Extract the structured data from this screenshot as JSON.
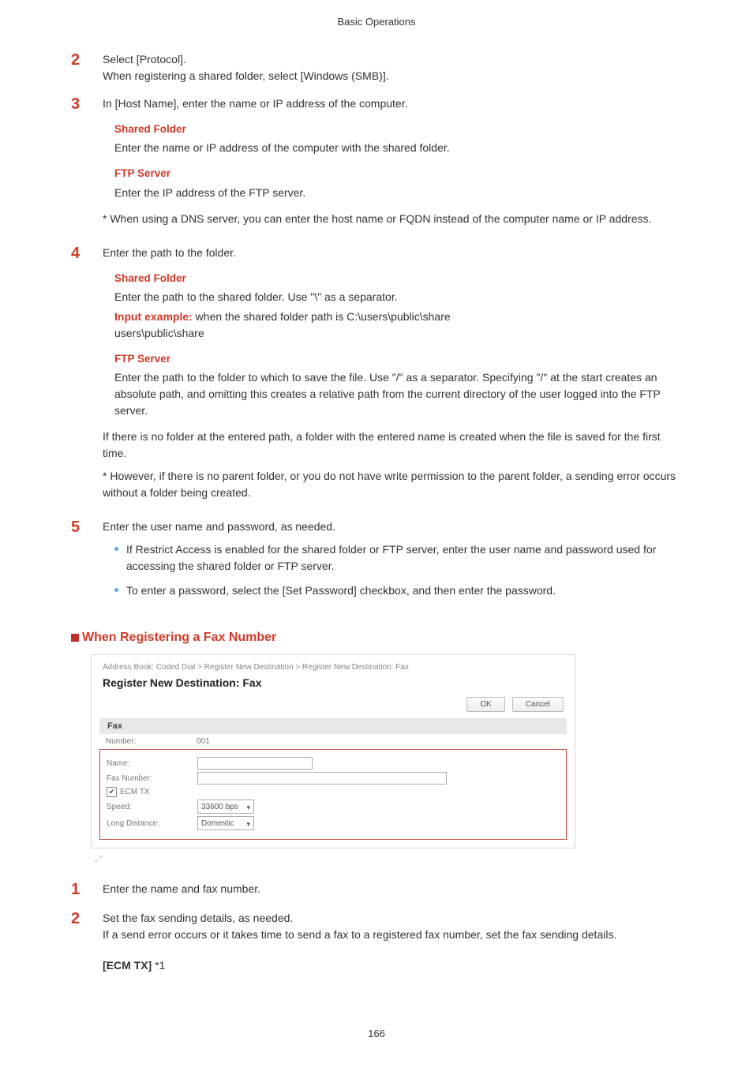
{
  "header": {
    "title": "Basic Operations"
  },
  "steps_a": [
    {
      "num": "2",
      "lines": [
        "Select [Protocol].",
        "When registering a shared folder, select [Windows (SMB)]."
      ]
    },
    {
      "num": "3",
      "lines": [
        "In [Host Name], enter the name or IP address of the computer."
      ],
      "subs": [
        {
          "heading": "Shared Folder",
          "body": "Enter the name or IP address of the computer with the shared folder."
        },
        {
          "heading": "FTP Server",
          "body": "Enter the IP address of the FTP server."
        }
      ],
      "note": "* When using a DNS server, you can enter the host name or FQDN instead of the computer name or IP address."
    },
    {
      "num": "4",
      "lines": [
        "Enter the path to the folder."
      ],
      "subs4": {
        "sf_heading": "Shared Folder",
        "sf_body": "Enter the path to the shared folder. Use \"\\\" as a separator.",
        "input_ex_label": "Input example:",
        "input_ex_text": " when the shared folder path is C:\\users\\public\\share",
        "input_ex_line2": "users\\public\\share",
        "ftp_heading": "FTP Server",
        "ftp_body": "Enter the path to the folder to which to save the file. Use \"/\" as a separator. Specifying \"/\" at the start creates an absolute path, and omitting this creates a relative path from the current directory of the user logged into the FTP server."
      },
      "extra": [
        "If there is no folder at the entered path, a folder with the entered name is created when the file is saved for the first time.",
        "* However, if there is no parent folder, or you do not have write permission to the parent folder, a sending error occurs without a folder being created."
      ]
    },
    {
      "num": "5",
      "lines": [
        "Enter the user name and password, as needed."
      ],
      "bullets": [
        "If Restrict Access is enabled for the shared folder or FTP server, enter the user name and password used for accessing the shared folder or FTP server.",
        "To enter a password, select the [Set Password] checkbox, and then enter the password."
      ]
    }
  ],
  "section": {
    "title": "When Registering a Fax Number"
  },
  "ui": {
    "breadcrumb": "Address Book: Coded Dial > Register New Destination > Register New Destination: Fax",
    "title": "Register New Destination: Fax",
    "ok": "OK",
    "cancel": "Cancel",
    "tab": "Fax",
    "rows": {
      "number_label": "Number:",
      "number_value": "001",
      "name_label": "Name:",
      "fax_label": "Fax Number:",
      "ecm_label": "ECM TX",
      "speed_label": "Speed:",
      "speed_value": "33600 bps",
      "long_label": "Long Distance:",
      "long_value": "Domestic"
    }
  },
  "steps_b": [
    {
      "num": "1",
      "lines": [
        "Enter the name and fax number."
      ]
    },
    {
      "num": "2",
      "lines": [
        "Set the fax sending details, as needed.",
        "If a send error occurs or it takes time to send a fax to a registered fax number, set the fax sending details."
      ],
      "bold_item": "[ECM TX]",
      "bold_suffix": " *1"
    }
  ],
  "page_number": "166"
}
